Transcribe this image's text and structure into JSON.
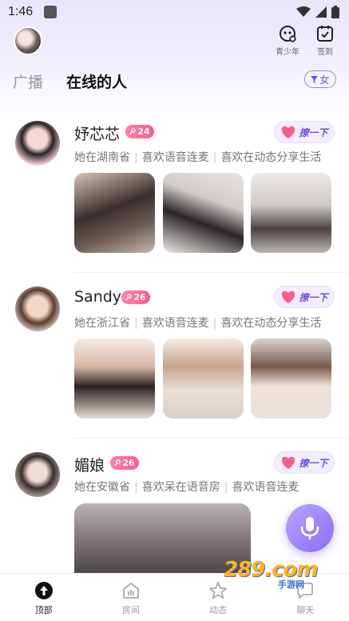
{
  "status_bar": {
    "time": "1:46"
  },
  "header": {
    "youth_label": "青少年",
    "checkin_label": "签到"
  },
  "tabs": {
    "broadcast": "广播",
    "online": "在线的人",
    "filter": "女"
  },
  "greet_label": "撩一下",
  "users": [
    {
      "name": "妤芯芯",
      "age": "24",
      "tags": [
        "她在湖南省",
        "喜欢语音连麦",
        "喜欢在动态分享生活"
      ]
    },
    {
      "name": "Sandy",
      "age": "26",
      "tags": [
        "她在浙江省",
        "喜欢语音连麦",
        "喜欢在动态分享生活"
      ]
    },
    {
      "name": "媚娘",
      "age": "26",
      "tags": [
        "她在安徽省",
        "喜欢呆在语音房",
        "喜欢语音连麦"
      ]
    }
  ],
  "bottom_nav": [
    {
      "label": "顶部",
      "icon": "arrow-up-circle-icon"
    },
    {
      "label": "房间",
      "icon": "room-icon"
    },
    {
      "label": "动态",
      "icon": "star-icon"
    },
    {
      "label": "聊天",
      "icon": "chat-icon"
    }
  ],
  "watermark": {
    "main": "289.com",
    "sub": "手游网"
  },
  "colors": {
    "accent": "#7a5ce8",
    "badge": "#ff6a95"
  }
}
